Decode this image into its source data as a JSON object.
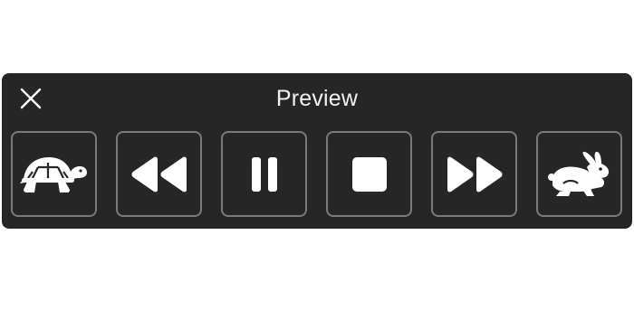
{
  "window": {
    "title": "Preview"
  },
  "icons": {
    "close": "close-icon",
    "slower": "turtle-icon",
    "rewind": "rewind-icon",
    "pause": "pause-icon",
    "stop": "stop-icon",
    "fast_forward": "fast-forward-icon",
    "faster": "rabbit-icon"
  },
  "colors": {
    "panel_background": "#262626",
    "button_border": "#7a7a7a",
    "icon": "#ffffff",
    "title_text": "#f2f2f2"
  }
}
